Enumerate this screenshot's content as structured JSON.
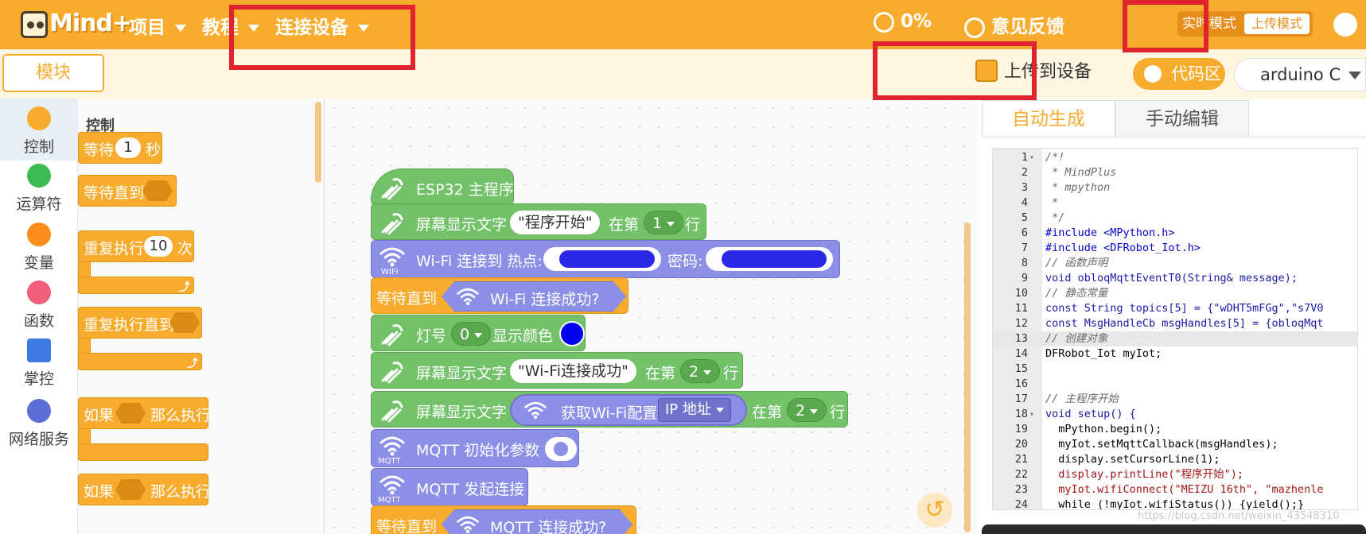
{
  "app": {
    "logo_text": "Mind+",
    "menu": [
      "项目",
      "教程",
      "连接设备"
    ],
    "progress": "0%",
    "feedback": "意见反馈",
    "mode_realtime": "实时模式",
    "mode_upload": "上传模式"
  },
  "toolbar": {
    "modules": "模块",
    "upload_to_device": "上传到设备",
    "code_area": "代码区",
    "board": "arduino C"
  },
  "categories": [
    "控制",
    "运算符",
    "变量",
    "函数",
    "掌控",
    "网络服务"
  ],
  "category_colors": [
    "#f7ac2e",
    "#3cba54",
    "#fb8c1e",
    "#f25f7a",
    "#3d7be0",
    "#5b6fd6"
  ],
  "palette": {
    "title": "控制",
    "wait_label": "等待",
    "wait_value": "1",
    "wait_unit": "秒",
    "wait_until": "等待直到",
    "repeat_label": "重复执行",
    "repeat_value": "10",
    "repeat_unit": "次",
    "repeat_until": "重复执行直到",
    "if_then": "如果",
    "if_then_suffix": "那么执行",
    "if_else_partial": "如果",
    "if_else_partial_suffix": "那么执行"
  },
  "workspace": {
    "hat": "ESP32 主程序",
    "display1_label": "屏幕显示文字",
    "display1_text": "\"程序开始\"",
    "display1_at": "在第",
    "display1_line": "1",
    "display1_suffix": "行",
    "wifi_label": "Wi-Fi 连接到 热点:",
    "wifi_pwd": "密码:",
    "wifi_icon_label": "WIFI",
    "wait_until": "等待直到",
    "wifi_connected": "Wi-Fi 连接成功?",
    "led_label": "灯号",
    "led_value": "0",
    "led_color": "显示颜色",
    "display2_label": "屏幕显示文字",
    "display2_text": "\"Wi-Fi连接成功\"",
    "display2_at": "在第",
    "display2_line": "2",
    "display2_suffix": "行",
    "display3_label": "屏幕显示文字",
    "wifi_config": "获取Wi-Fi配置",
    "ip_option": "IP 地址",
    "display3_at": "在第",
    "display3_line": "2",
    "display3_suffix": "行",
    "mqtt_init": "MQTT 初始化参数",
    "mqtt_icon_label": "MQTT",
    "mqtt_connect": "MQTT 发起连接",
    "wait_until2": "等待直到",
    "mqtt_connected": "MQTT 连接成功?"
  },
  "code_panel": {
    "tab_auto": "自动生成",
    "tab_manual": "手动编辑",
    "lines": [
      {
        "n": "1",
        "fold": true,
        "t": "/*!",
        "c": "cm"
      },
      {
        "n": "2",
        "t": " * MindPlus",
        "c": "cm"
      },
      {
        "n": "3",
        "t": " * mpython",
        "c": "cm"
      },
      {
        "n": "4",
        "t": " *",
        "c": "cm"
      },
      {
        "n": "5",
        "t": " */",
        "c": "cm"
      },
      {
        "n": "6",
        "t": "#include <MPython.h>",
        "c": "inc"
      },
      {
        "n": "7",
        "t": "#include <DFRobot_Iot.h>",
        "c": "inc"
      },
      {
        "n": "8",
        "t": "// 函数声明",
        "c": "cm"
      },
      {
        "n": "9",
        "t": "void obloqMqttEventT0(String& message);",
        "c": "kw"
      },
      {
        "n": "10",
        "t": "// 静态常量",
        "c": "cm"
      },
      {
        "n": "11",
        "t": "const String topics[5] = {\"wDHT5mFGg\",\"s7V0",
        "c": "kw"
      },
      {
        "n": "12",
        "t": "const MsgHandleCb msgHandles[5] = {obloqMqt",
        "c": "kw"
      },
      {
        "n": "13",
        "t": "// 创建对象",
        "c": "cm",
        "hl": true
      },
      {
        "n": "14",
        "t": "DFRobot_Iot myIot;",
        "c": ""
      },
      {
        "n": "15",
        "t": "",
        "c": ""
      },
      {
        "n": "16",
        "t": "",
        "c": ""
      },
      {
        "n": "17",
        "t": "// 主程序开始",
        "c": "cm"
      },
      {
        "n": "18",
        "fold": true,
        "t": "void setup() {",
        "c": "kw"
      },
      {
        "n": "19",
        "t": "  mPython.begin();",
        "c": ""
      },
      {
        "n": "20",
        "t": "  myIot.setMqttCallback(msgHandles);",
        "c": ""
      },
      {
        "n": "21",
        "t": "  display.setCursorLine(1);",
        "c": ""
      },
      {
        "n": "22",
        "t": "  display.printLine(\"程序开始\");",
        "c": "str"
      },
      {
        "n": "23",
        "t": "  myIot.wifiConnect(\"MEIZU 16th\", \"mazhenle",
        "c": "str"
      },
      {
        "n": "24",
        "t": "  while (!myIot.wifiStatus()) {yield();}",
        "c": ""
      }
    ]
  },
  "watermark": "https://blog.csdn.net/weixin_43548310"
}
